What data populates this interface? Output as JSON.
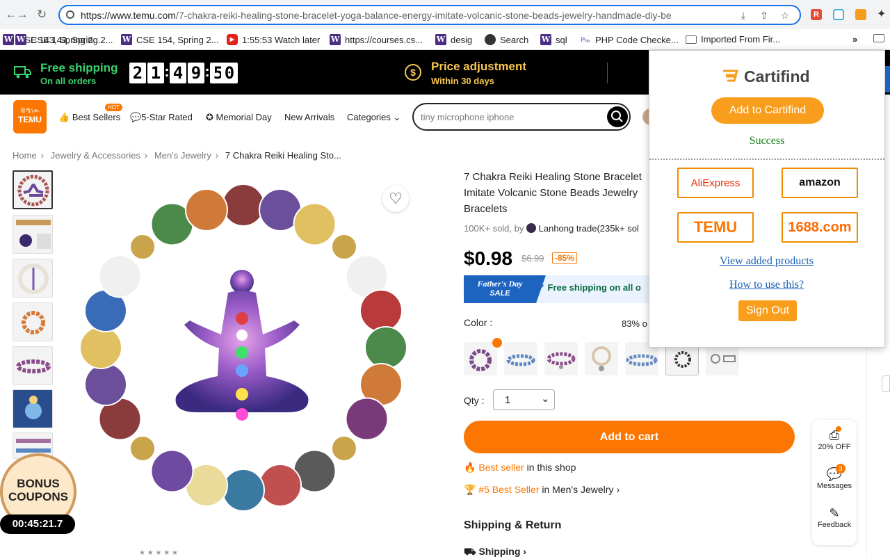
{
  "browser": {
    "url": "https://www.temu.com/7-chakra-reiki-healing-stone-bracelet-yoga-balance-energy-imitate-volcanic-stone-beads-jewelry-handmade-diy-be",
    "url_host": "https://www.temu.com",
    "url_path": "/7-chakra-reiki-healing-stone-bracelet-yoga-balance-energy-imitate-volcanic-stone-beads-jewelry-handmade-diy-be",
    "bookmarks": [
      {
        "label": "CSE 143, Spring 2...",
        "icon": "w-icon"
      },
      {
        "label": "CSE 154, Spring 2...",
        "icon": "w-icon"
      },
      {
        "label": "1:55:53 Watch later",
        "icon": "youtube-icon"
      },
      {
        "label": "https://courses.cs...",
        "icon": "w-icon"
      },
      {
        "label": "desig",
        "icon": "w-icon"
      },
      {
        "label": "Search",
        "icon": "globe-icon"
      },
      {
        "label": "sql",
        "icon": "w-icon"
      },
      {
        "label": "PHP Code Checke...",
        "icon": "php-icon"
      },
      {
        "label": "Imported From Fir...",
        "icon": "folder-icon"
      }
    ],
    "more": "»"
  },
  "promo": {
    "free_title": "Free shipping",
    "free_sub": "On all orders",
    "timer": [
      "2",
      "1",
      "4",
      "9",
      "5",
      "0"
    ],
    "price_title": "Price adjustment",
    "price_sub": "Within 30 days"
  },
  "nav": {
    "logo_top": "ꕤꗀꖷꖳ",
    "logo": "TEMU",
    "best_sellers": "Best Sellers",
    "hot": "HOT",
    "five_star": "5-Star Rated",
    "memorial": "Memorial Day",
    "new_arrivals": "New Arrivals",
    "categories": "Categories",
    "search_value": "tiny microphone iphone"
  },
  "breadcrumb": [
    "Home",
    "Jewelry & Accessories",
    "Men's Jewelry",
    "7 Chakra Reiki Healing Sto..."
  ],
  "product": {
    "title_lines": [
      "7 Chakra Reiki Healing Stone Bracelet",
      "Imitate Volcanic Stone Beads Jewelry",
      "Bracelets"
    ],
    "sold": "100K+ sold, by",
    "seller": "Lanhong trade(235k+ sol",
    "price": "$0.98",
    "orig_price": "$6.99",
    "discount": "-85%",
    "fathers_day_1": "Father's Day",
    "fathers_day_2": "SALE",
    "free_ship": "Free shipping on all o",
    "color_label": "Color :",
    "percent_note": "83% o",
    "qty_label": "Qty :",
    "qty_value": "1",
    "add_to_cart": "Add to cart",
    "best_seller_1": "Best seller",
    "best_seller_1b": " in this shop",
    "best_seller_2": "#5 Best Seller",
    "best_seller_2b": " in Men's Jewelry",
    "shipping_return": "Shipping & Return",
    "shipping": "Shipping"
  },
  "bonus": {
    "line1": "BONUS",
    "line2": "COUPONS",
    "timer": "00:45:21.7"
  },
  "side": {
    "off": "20% OFF",
    "messages": "Messages",
    "messages_badge": "3",
    "feedback": "Feedback"
  },
  "cartifind": {
    "brand": "Cartifind",
    "add_button": "Add to Cartifind",
    "status": "Success",
    "stores": [
      "AliExpress",
      "amazon",
      "TEMU",
      "1688.com"
    ],
    "view_link": "View added products",
    "howto_link": "How to use this?",
    "sign_out": "Sign Out"
  },
  "colors": {
    "temu_orange": "#fb7701",
    "cartifind_orange": "#f99d1c",
    "success_green": "#1a7f1a",
    "link_blue": "#1a5fb4"
  }
}
